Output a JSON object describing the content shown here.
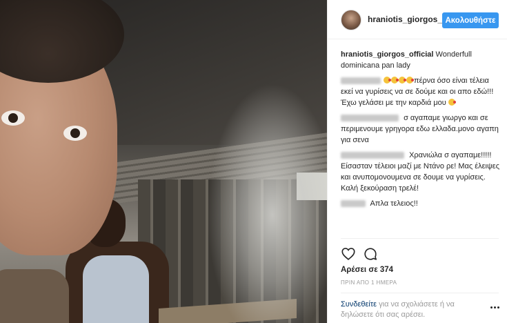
{
  "post": {
    "header": {
      "username": "hraniotis_giorgos_",
      "follow_label": "Ακολουθήστε"
    },
    "caption": {
      "username": "hraniotis_giorgos_official",
      "text": "Wonderfull dominicana pan lady"
    },
    "comments": [
      {
        "text_before_emoji": "",
        "emoji_count": 4,
        "text": "πέρνα όσο είναι τέλεια εκεί να γυρίσεις να σε δούμε και οι απο εδώ!!! Έχω γελάσει με την καρδιά μου",
        "trailing_emoji": 1
      },
      {
        "text_before_emoji": "",
        "emoji_count": 0,
        "text": "σ αγαπαμε γιωργο και σε περιμενουμε γρηγορα εδω ελλαδα.μονο αγαπη για σενα",
        "trailing_emoji": 0
      },
      {
        "text_before_emoji": "",
        "emoji_count": 0,
        "text": "Χρανιώλα σ αγαπαμε!!!!! Είσασταν τέλειοι μαζί με Ντάνο ρε! Μας έλειψες και ανυπομονουμενα σε δουμε να γυρίσεις. Καλή ξεκούραση τρελέ!",
        "trailing_emoji": 0
      },
      {
        "text_before_emoji": "",
        "emoji_count": 0,
        "text": "Απλα τελειος!!",
        "trailing_emoji": 0
      }
    ],
    "likes_label": "Αρέσει σε 374",
    "timestamp": "ΠΡΙΝ ΑΠΟ 1 ΗΜΕΡΑ",
    "login": {
      "link": "Συνδεθείτε",
      "text": "για να σχολιάσετε ή να δηλώσετε ότι σας αρέσει."
    },
    "icons": {
      "like": "heart-icon",
      "comment": "comment-icon",
      "more": "more-options-icon"
    },
    "colors": {
      "follow_button": "#3897f0",
      "login_link": "#003569",
      "muted": "#999999"
    }
  }
}
